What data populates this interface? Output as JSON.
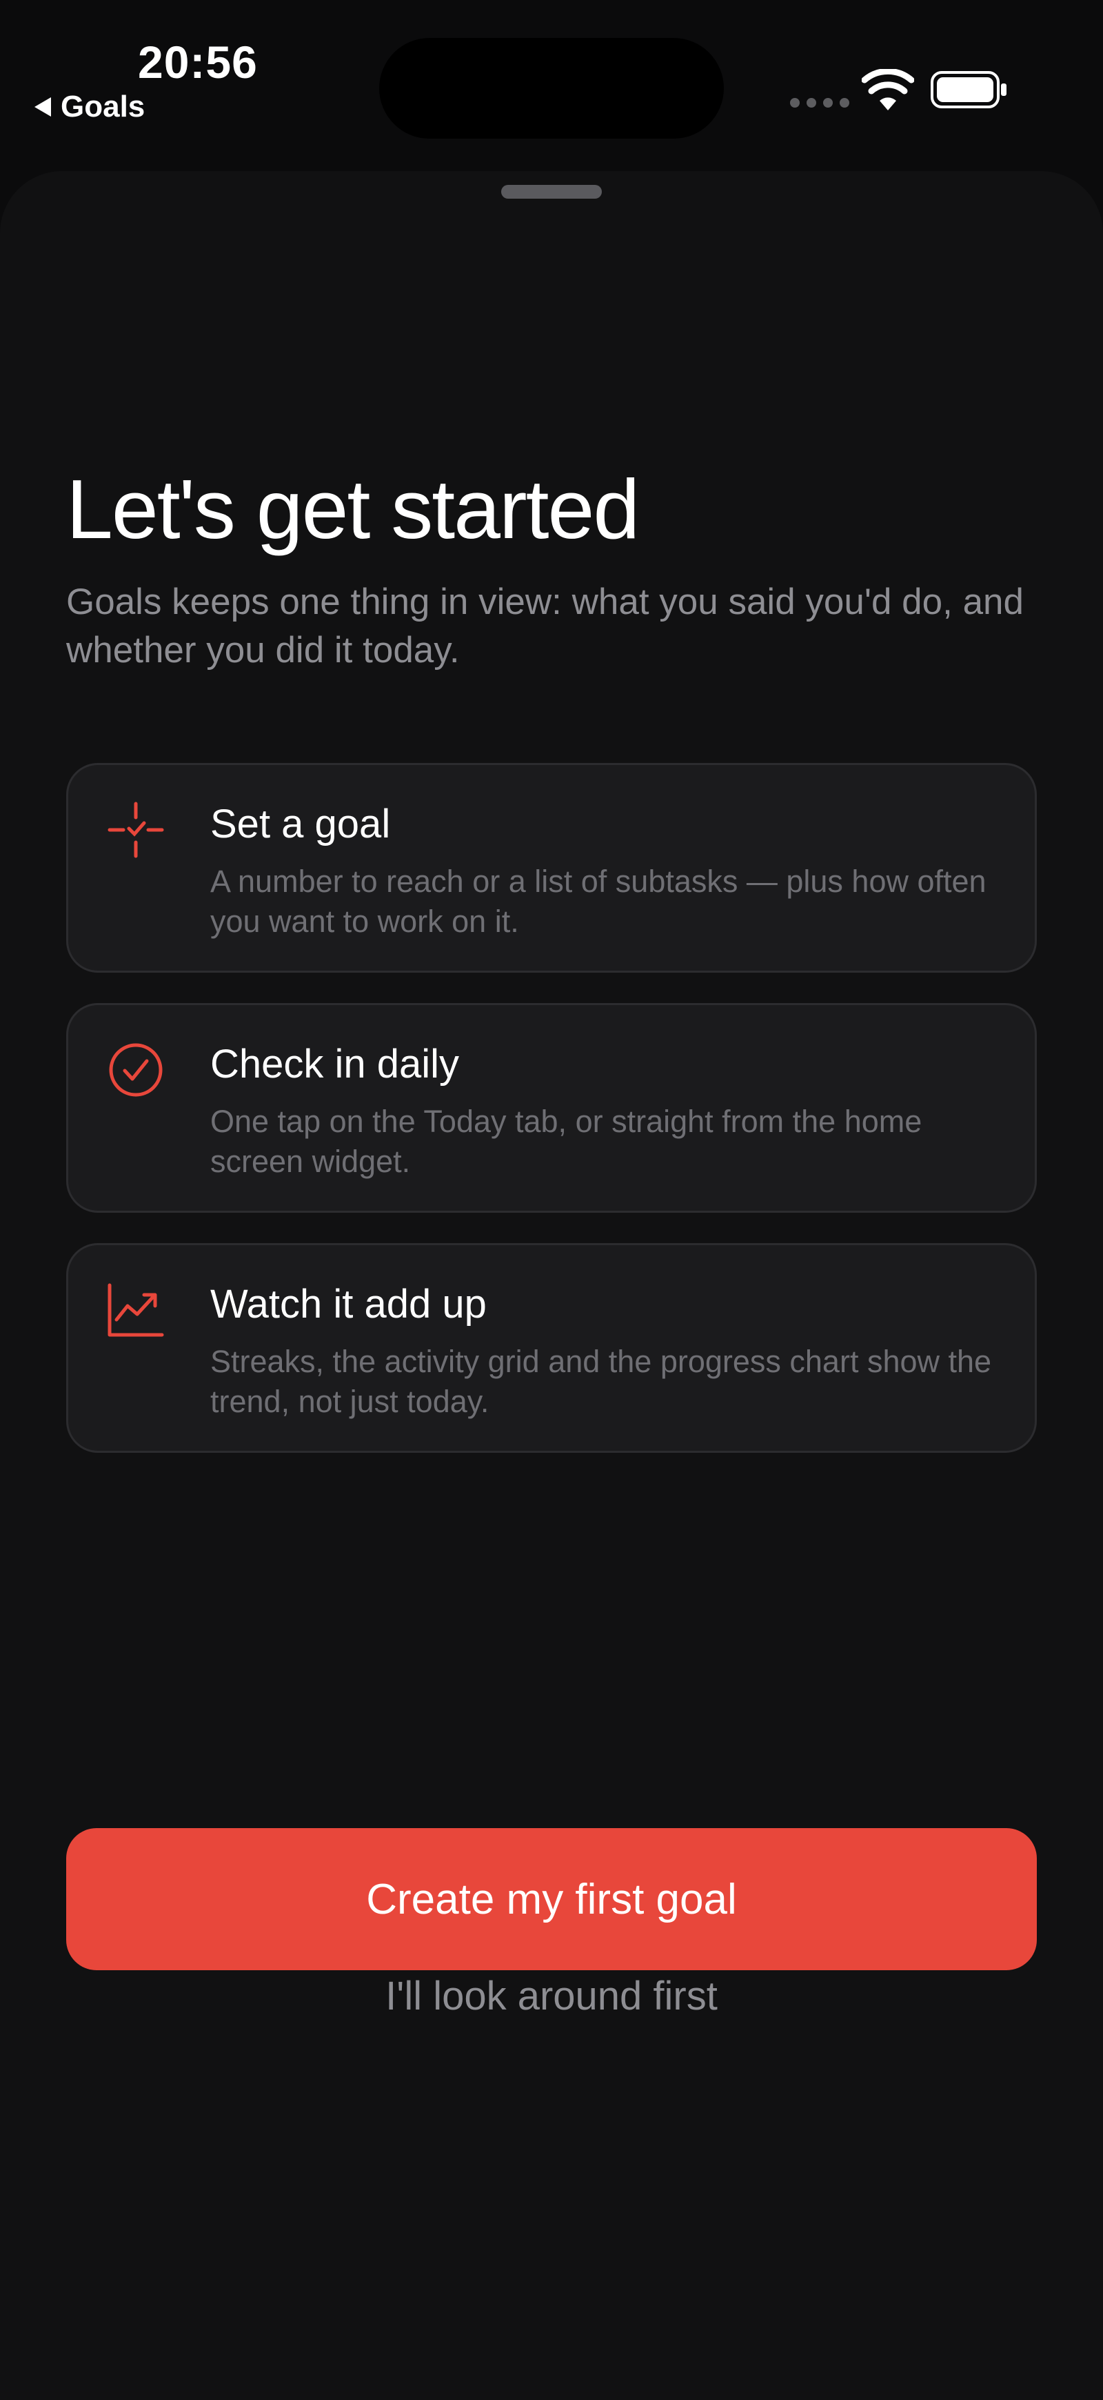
{
  "status_bar": {
    "time": "20:56",
    "back_label": "Goals"
  },
  "onboarding": {
    "title": "Let's get started",
    "subtitle": "Goals keeps one thing in view: what you said you'd do, and whether you did it today.",
    "features": [
      {
        "icon": "target-check-icon",
        "title": "Set a goal",
        "description": "A number to reach or a list of subtasks — plus how often you want to work on it."
      },
      {
        "icon": "checkmark-circle-icon",
        "title": "Check in daily",
        "description": "One tap on the Today tab, or straight from the home screen widget."
      },
      {
        "icon": "trend-chart-icon",
        "title": "Watch it add up",
        "description": "Streaks, the activity grid and the progress chart show the trend, not just today."
      }
    ],
    "primary_button": "Create my first goal",
    "secondary_button": "I'll look around first"
  },
  "colors": {
    "accent": "#e8473b",
    "background": "#111112",
    "card": "#1b1b1d",
    "secondary_text": "#8e8e93"
  }
}
